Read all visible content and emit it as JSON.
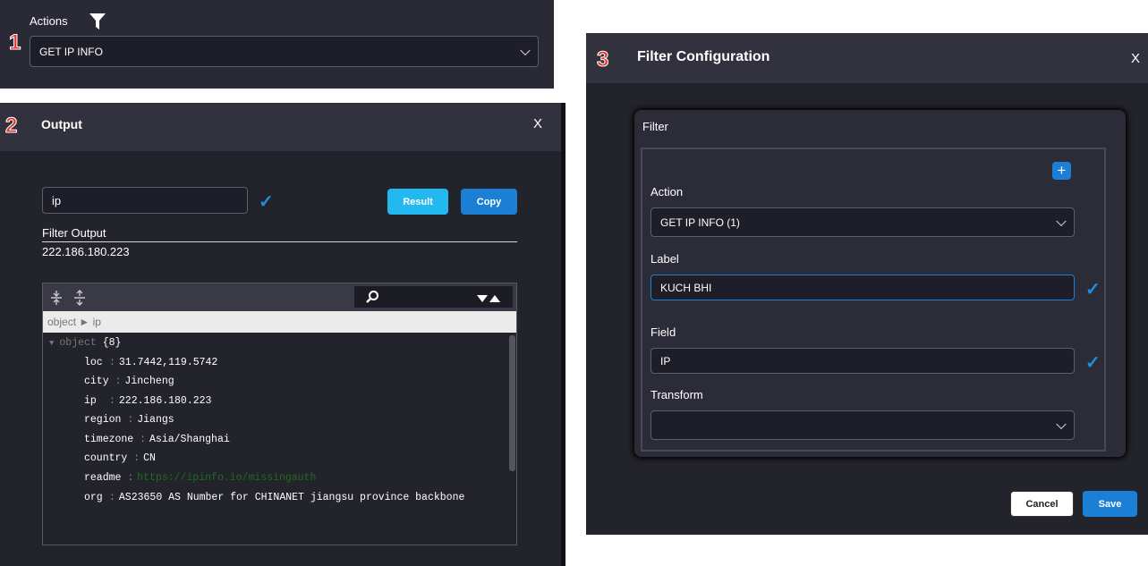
{
  "panel1": {
    "step": "1",
    "title": "Actions",
    "filter_icon": "filter-icon",
    "action_select": "GET IP INFO"
  },
  "panel2": {
    "step": "2",
    "title": "Output",
    "close": "X",
    "filter_input": "ip",
    "result_label": "Result",
    "copy_label": "Copy",
    "filter_output_label": "Filter Output",
    "filter_output_value": "222.186.180.223",
    "viewer": {
      "breadcrumb": "object ► ip",
      "root_label": "object",
      "root_count": "{8}",
      "rows": [
        {
          "key": "loc",
          "value": "31.7442,119.5742"
        },
        {
          "key": "city",
          "value": "Jincheng"
        },
        {
          "key": "ip",
          "value": "222.186.180.223"
        },
        {
          "key": "region",
          "value": "Jiangs"
        },
        {
          "key": "timezone",
          "value": "Asia/Shanghai"
        },
        {
          "key": "country",
          "value": "CN"
        },
        {
          "key": "readme",
          "value": "https://ipinfo.io/missingauth"
        },
        {
          "key": "org",
          "value": "AS23650 AS Number for CHINANET jiangsu province backbone"
        }
      ]
    }
  },
  "panel3": {
    "step": "3",
    "title": "Filter Configuration",
    "close": "X",
    "filter_heading": "Filter",
    "add": "+",
    "action_label": "Action",
    "action_value": "GET IP INFO (1)",
    "label_label": "Label",
    "label_value": "KUCH BHI",
    "field_label": "Field",
    "field_value": "IP",
    "transform_label": "Transform",
    "transform_value": "",
    "cancel_label": "Cancel",
    "save_label": "Save"
  },
  "colors": {
    "accent_blue": "#1c7fd6",
    "result_cyan": "#24b8f0",
    "step_red": "#e8302c",
    "panel_bg": "#2c2c38"
  }
}
